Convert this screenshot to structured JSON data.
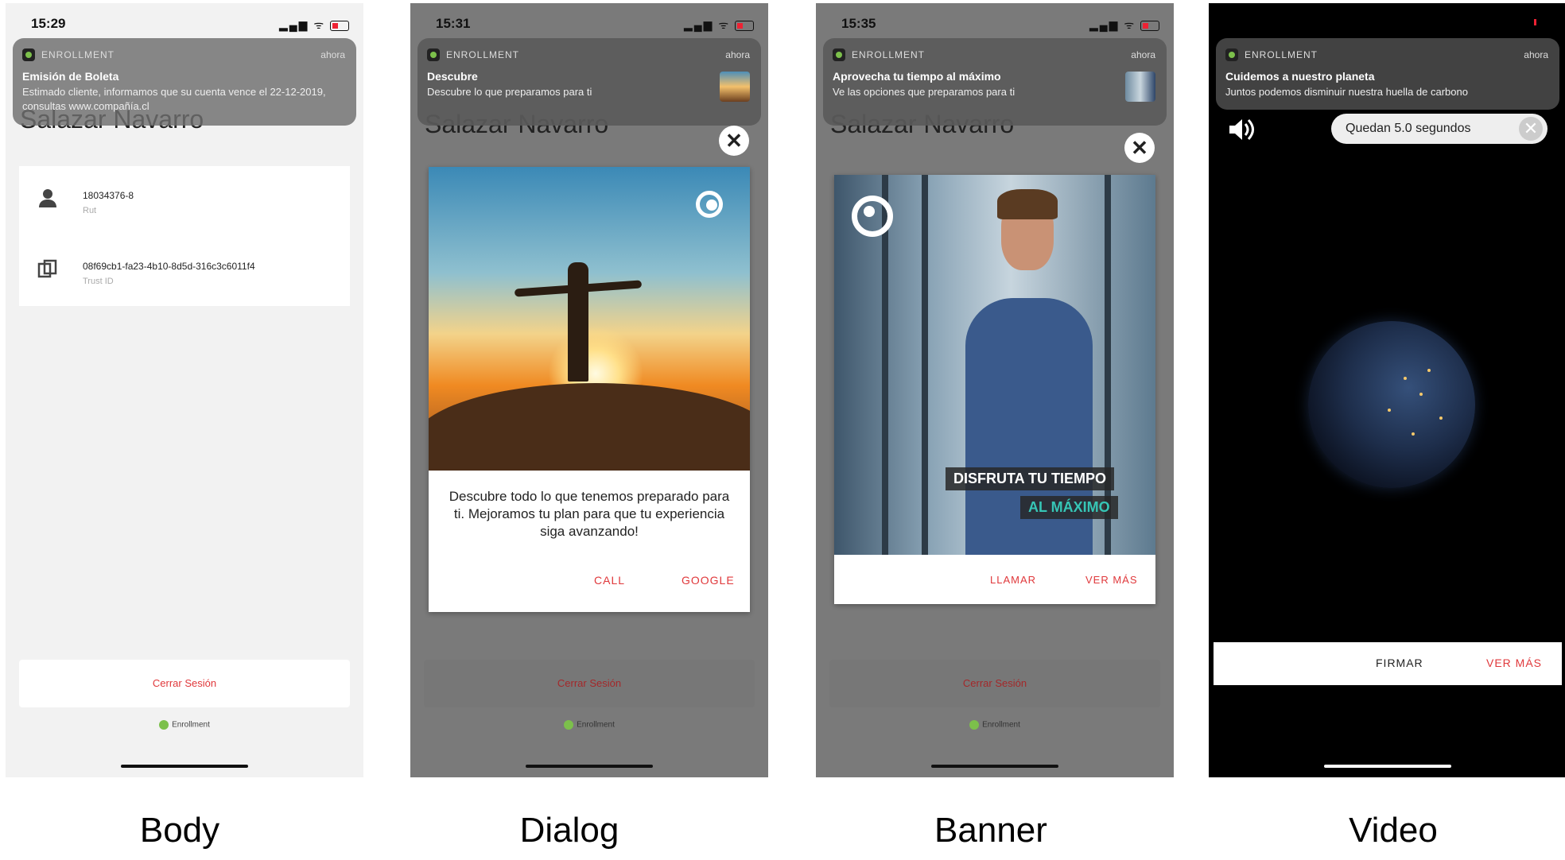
{
  "notification_app": "ENROLLMENT",
  "notification_when": "ahora",
  "status_icons": "▂▄▆ ᯤ",
  "screens": {
    "body": {
      "time": "15:29",
      "notif_title": "Emisión de Boleta",
      "notif_body": "Estimado cliente, informamos que su cuenta vence el 22-12-2019, consultas www.compañía.cl",
      "bg_name": "Salazar Navarro",
      "rut_value": "18034376-8",
      "rut_label": "Rut",
      "trust_value": "08f69cb1-fa23-4b10-8d5d-316c3c6011f4",
      "trust_label": "Trust ID",
      "logout": "Cerrar Sesión",
      "brand": "Enrollment"
    },
    "dialog": {
      "time": "15:31",
      "notif_title": "Descubre",
      "notif_body": "Descubre lo que preparamos para ti",
      "bg_name": "Salazar Navarro",
      "text": "Descubre todo lo que tenemos preparado para ti. Mejoramos tu plan para que tu experiencia siga avanzando!",
      "btn1": "CALL",
      "btn2": "GOOGLE",
      "logout": "Cerrar Sesión",
      "brand": "Enrollment"
    },
    "banner": {
      "time": "15:35",
      "notif_title": "Aprovecha tu tiempo al máximo",
      "notif_body": "Ve las opciones que preparamos para ti",
      "bg_name": "Salazar Navarro",
      "tag1": "DISFRUTA TU TIEMPO",
      "tag2": "AL MÁXIMO",
      "btn1": "LLAMAR",
      "btn2": "VER MÁS",
      "logout": "Cerrar Sesión",
      "brand": "Enrollment"
    },
    "video": {
      "notif_title": "Cuidemos a nuestro planeta",
      "notif_body": "Juntos podemos disminuir nuestra huella de carbono",
      "timer": "Quedan 5.0 segundos",
      "btn1": "FIRMAR",
      "btn2": "VER MÁS"
    }
  },
  "captions": [
    "Body",
    "Dialog",
    "Banner",
    "Video"
  ],
  "colors": {
    "accent_red": "#e0383b",
    "brand_green": "#7cc04b"
  }
}
